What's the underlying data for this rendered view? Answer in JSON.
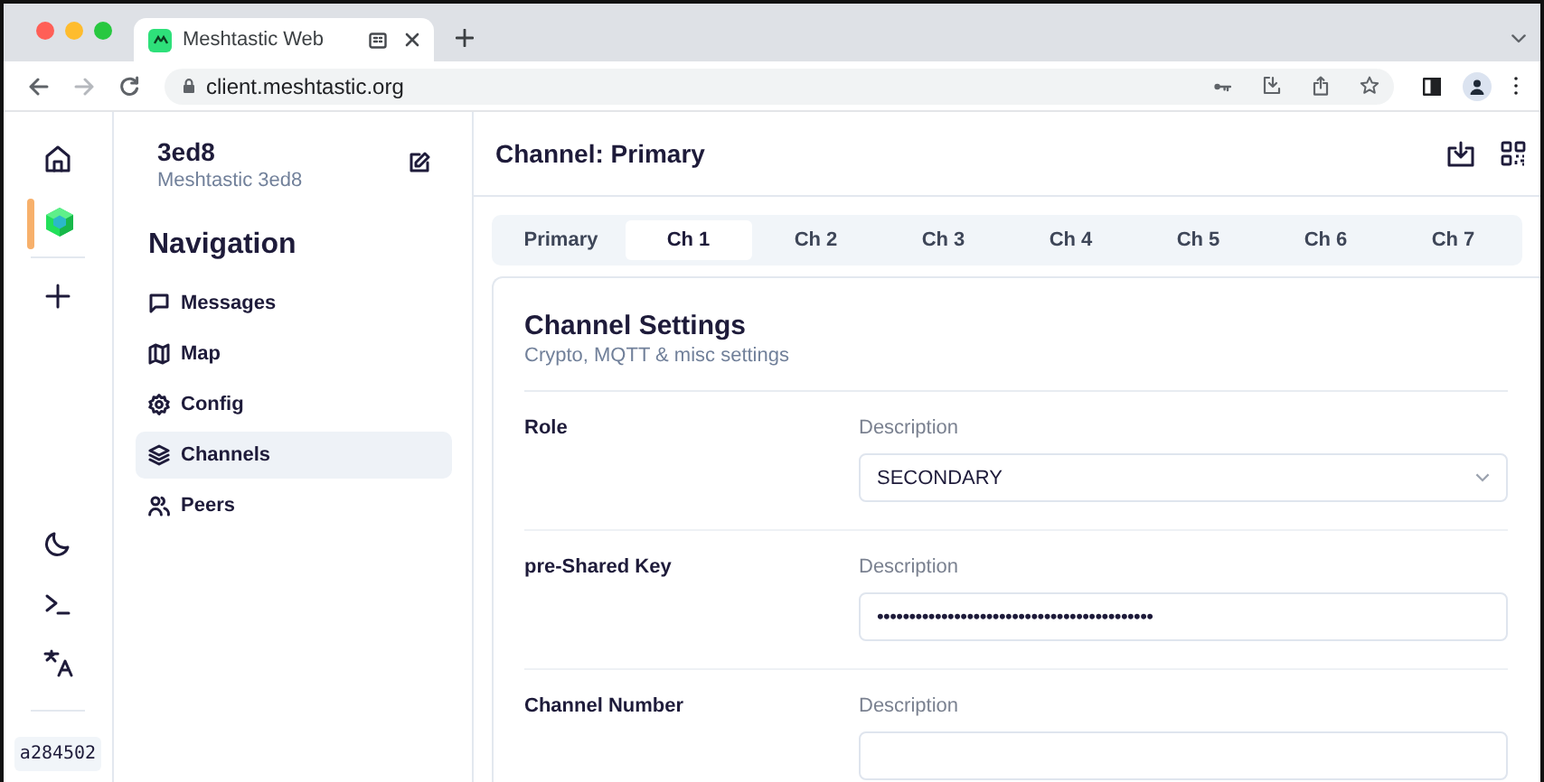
{
  "browser": {
    "tab": {
      "title": "Meshtastic Web"
    },
    "url": "client.meshtastic.org"
  },
  "rail": {
    "nodes": [
      {
        "selected": true
      }
    ],
    "node_id": "a284502"
  },
  "sidebar": {
    "device_name": "3ed8",
    "device_subtitle": "Meshtastic 3ed8",
    "heading": "Navigation",
    "items": [
      {
        "label": "Messages",
        "kind": "messages",
        "selected": false
      },
      {
        "label": "Map",
        "kind": "map",
        "selected": false
      },
      {
        "label": "Config",
        "kind": "config",
        "selected": false
      },
      {
        "label": "Channels",
        "kind": "channels",
        "selected": true
      },
      {
        "label": "Peers",
        "kind": "peers",
        "selected": false
      }
    ]
  },
  "main": {
    "title": "Channel: Primary",
    "tabs": [
      {
        "label": "Primary",
        "selected": false
      },
      {
        "label": "Ch 1",
        "selected": true
      },
      {
        "label": "Ch 2",
        "selected": false
      },
      {
        "label": "Ch 3",
        "selected": false
      },
      {
        "label": "Ch 4",
        "selected": false
      },
      {
        "label": "Ch 5",
        "selected": false
      },
      {
        "label": "Ch 6",
        "selected": false
      },
      {
        "label": "Ch 7",
        "selected": false
      }
    ],
    "card": {
      "title": "Channel Settings",
      "subtitle": "Crypto, MQTT & misc settings",
      "fields": [
        {
          "label": "Role",
          "description": "Description",
          "kind": "select",
          "value": "SECONDARY"
        },
        {
          "label": "pre-Shared Key",
          "description": "Description",
          "kind": "password",
          "value": "•••••••••••••••••••••••••••••••••••••••••••"
        },
        {
          "label": "Channel Number",
          "description": "Description",
          "kind": "text"
        }
      ]
    }
  }
}
